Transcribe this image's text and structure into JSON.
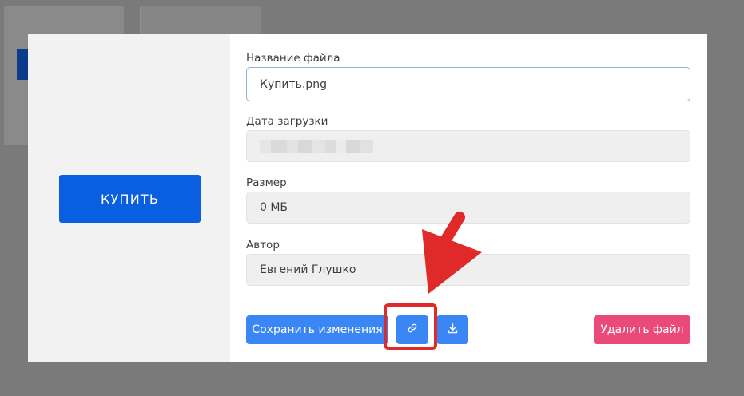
{
  "form": {
    "filename_label": "Название файла",
    "filename_value": "Купить.png",
    "upload_date_label": "Дата загрузки",
    "size_label": "Размер",
    "size_value": "0 МБ",
    "author_label": "Автор",
    "author_value": "Евгений Глушко"
  },
  "preview": {
    "buy_label": "КУПИТЬ"
  },
  "actions": {
    "save_label": "Сохранить изменения",
    "link_icon": "link-icon",
    "download_icon": "download-icon",
    "delete_label": "Удалить файл"
  },
  "colors": {
    "primary": "#3a86f5",
    "buy": "#0a5fe0",
    "danger": "#ea4a7a",
    "annotation": "#e02a2a"
  }
}
